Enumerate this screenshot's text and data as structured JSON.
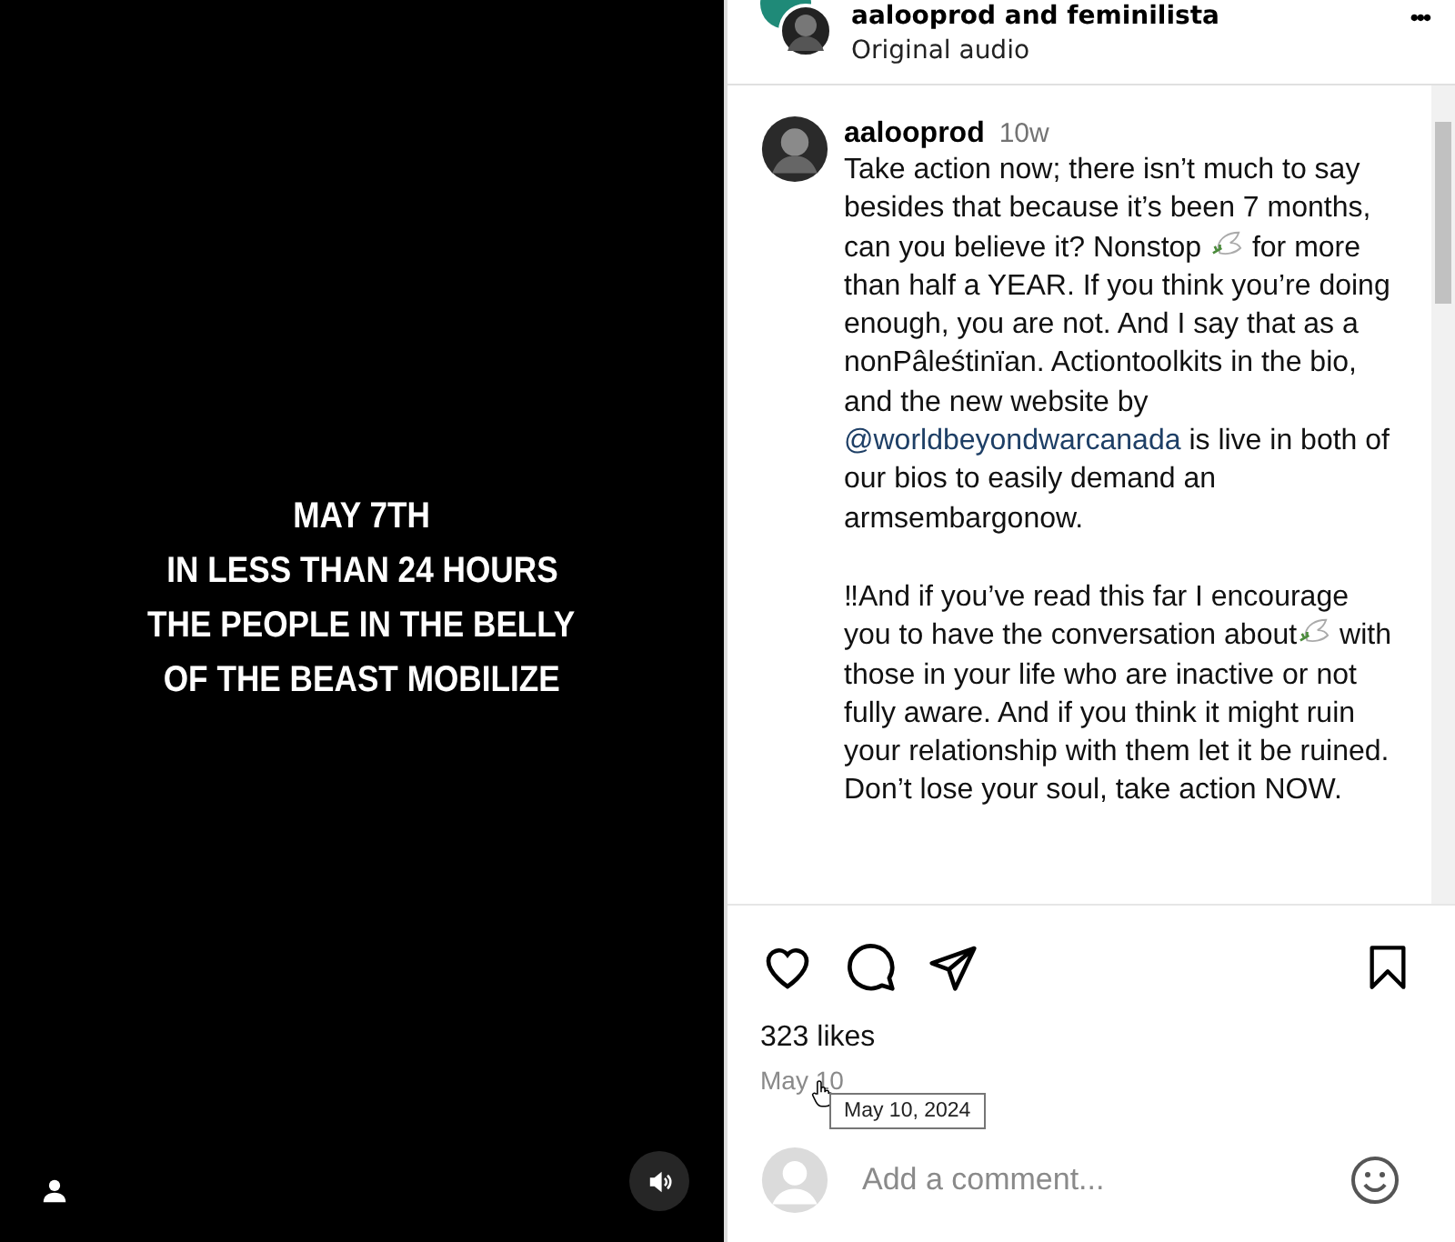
{
  "video": {
    "lines": [
      "MAY 7TH",
      "IN LESS THAN 24 HOURS",
      "THE PEOPLE IN THE BELLY",
      "OF THE BEAST MOBILIZE"
    ],
    "muted": false
  },
  "header": {
    "authors": "aalooprod and feminilista",
    "audio": "Original audio",
    "more": "•••"
  },
  "caption": {
    "username": "aalooprod",
    "age": "10w",
    "paragraphs": [
      [
        {
          "kind": "text",
          "text": "Take action now; there isn’t much to say besides that because it’s been 7 months, can you believe it? Nonstop "
        },
        {
          "kind": "emoji"
        },
        {
          "kind": "text",
          "text": " for more than half a YEAR. If you think you’re doing enough, you are not. And I say that as a nonPâleśtinïan. Actiontoolkits in the bio, and the new website by "
        },
        {
          "kind": "mention",
          "text": "@worldbeyondwarcanada"
        },
        {
          "kind": "text",
          "text": " is live in both of our bios to easily demand an armsembargonow."
        }
      ],
      [
        {
          "kind": "text",
          "text": "‼And if you’ve read this far I encourage you to have the conversation about"
        },
        {
          "kind": "emoji"
        },
        {
          "kind": "text",
          "text": " with those in your life who are inactive or not fully aware. And if you think it might ruin your relationship with them let it be ruined. Don’t lose your soul, take action NOW."
        }
      ]
    ]
  },
  "actions": {
    "liked": false,
    "saved": false
  },
  "likes": "323 likes",
  "date": "May 10",
  "tooltip": "May 10, 2024",
  "comment": {
    "placeholder": "Add a comment..."
  }
}
